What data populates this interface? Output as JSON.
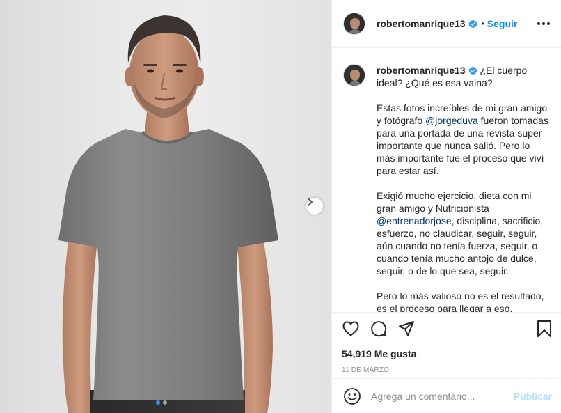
{
  "post": {
    "username": "robertomanrique13",
    "follow_label": "Seguir",
    "separator": "•",
    "caption_first_line": "¿El cuerpo ideal? ¿Qué es esa vaina?",
    "caption_p2_a": "Estas fotos increíbles de mi gran amigo y fotógrafo ",
    "caption_p2_mention": "@jorgeduva",
    "caption_p2_b": " fueron tomadas para una portada de una revista super importante que nunca salió. Pero lo más importante fue el proceso que viví para estar así.",
    "caption_p3_a": "Exigió mucho ejercicio, dieta con mi gran amigo y Nutricionista ",
    "caption_p3_mention": "@entrenadorjose",
    "caption_p3_b": ", disciplina, sacrificio, esfuerzo, no claudicar, seguir, seguir, aún cuando no tenía fuerza, seguir, o cuando tenía mucho antojo de dulce, seguir, o de lo que sea, seguir.",
    "caption_p4": "Pero lo más valioso no es el resultado, es el proceso para llegar a eso.",
    "likes": "54,919 Me gusta",
    "date": "11 DE MARZO",
    "comment_placeholder": "Agrega un comentario...",
    "publish_label": "Publicar"
  },
  "carousel": {
    "slide_count": 2,
    "active_index": 0
  },
  "icons": {
    "verified": "verified-badge-icon",
    "more": "more-options-icon",
    "next": "chevron-right-icon",
    "like": "heart-icon",
    "comment": "comment-bubble-icon",
    "share": "paper-plane-icon",
    "save": "bookmark-icon",
    "emoji": "smiley-icon"
  },
  "colors": {
    "accent": "#0095f6",
    "verified": "#3897f0",
    "mention": "#00376b",
    "publish_disabled": "#b2dffc",
    "muted": "#8e8e8e",
    "shirt": "#8a8a8a"
  }
}
